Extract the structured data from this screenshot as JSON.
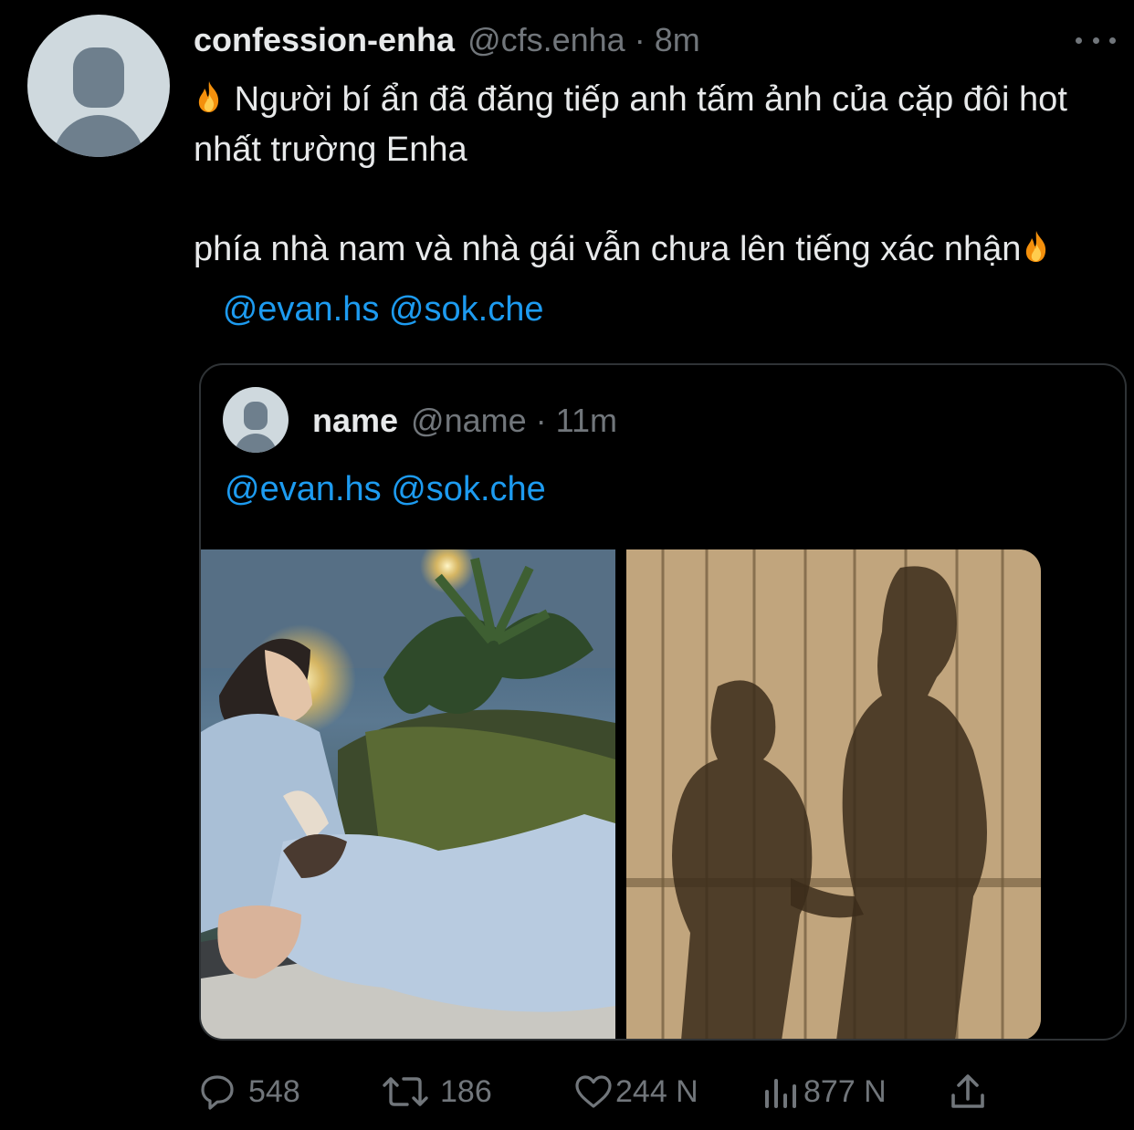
{
  "tweet": {
    "author": {
      "display_name": "confession-enha",
      "handle": "@cfs.enha",
      "time": "8m"
    },
    "text": {
      "line1": "Người bí ẩn đã đăng tiếp anh tấm ảnh của cặp đôi hot nhất trường Enha",
      "line2_before": "phía nhà nam và nhà gái vẫn chưa lên tiếng xác nhận",
      "mentions": [
        "@evan.hs",
        "@sok.che"
      ]
    },
    "emoji": "fire-emoji"
  },
  "quote": {
    "author": {
      "display_name": "name",
      "handle": "@name",
      "time": "11m"
    },
    "text": {
      "mention1": "@evan.hs",
      "mention2": "@sok.che"
    },
    "media": [
      "photo-couple-night",
      "photo-shadow-fence"
    ]
  },
  "actions": {
    "replies": "548",
    "retweets": "186",
    "likes": "244 N",
    "views": "877 N"
  },
  "colors": {
    "background": "#000000",
    "text": "#e7e9ea",
    "secondary": "#71767b",
    "link": "#1d9bf0",
    "border": "#2f3336"
  },
  "separator": "·"
}
